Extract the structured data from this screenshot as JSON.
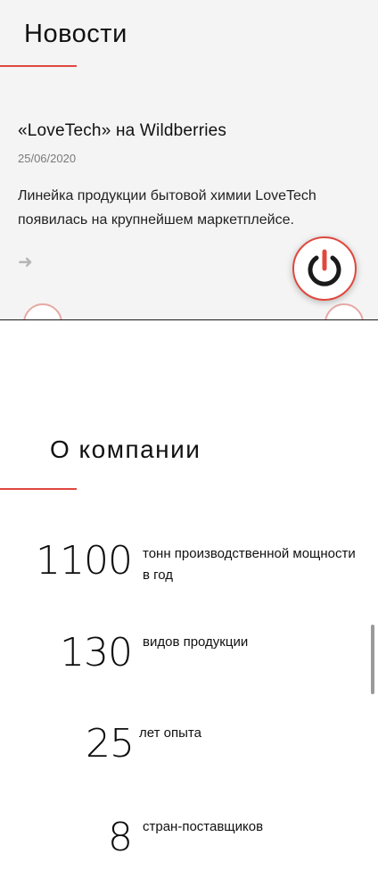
{
  "news": {
    "title": "Новости",
    "item": {
      "headline": "«LoveTech» на Wildberries",
      "date": "25/06/2020",
      "text": "Линейка продукции бытовой химии LoveTech появилась на крупнейшем маркетплейсе."
    },
    "more_icon": "arrow-right-icon",
    "prev_icon": "chevron-left-icon",
    "next_icon": "chevron-right-icon"
  },
  "power_button": {
    "icon": "power-icon",
    "accent": "#e0483e"
  },
  "about": {
    "title": "О компании",
    "stats": [
      {
        "number": "1100",
        "label": "тонн производственной мощности в год"
      },
      {
        "number": "130",
        "label": "видов продукции"
      },
      {
        "number": "25",
        "label": "лет опыта"
      },
      {
        "number": "8",
        "label": "стран-поставщиков"
      }
    ]
  },
  "colors": {
    "accent": "#e0483e",
    "news_bg": "#f4f4f4"
  }
}
